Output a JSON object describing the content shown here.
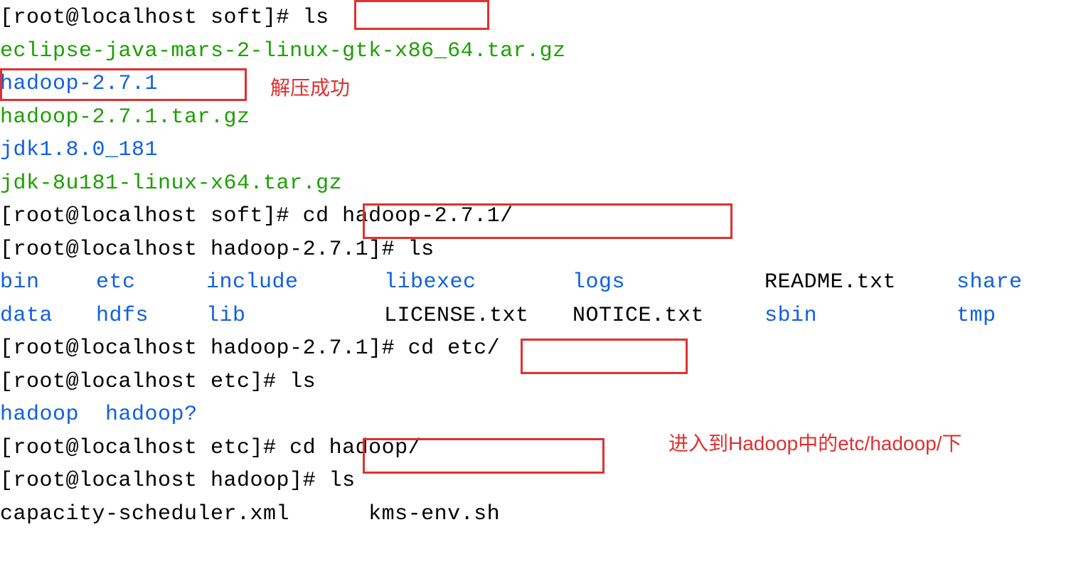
{
  "prompts": {
    "soft": "[root@localhost soft]# ",
    "hadoop271": "[root@localhost hadoop-2.7.1]# ",
    "etc": "[root@localhost etc]# ",
    "hadoop": "[root@localhost hadoop]# "
  },
  "commands": {
    "ls": "ls",
    "cd_hadoop271": "cd hadoop-2.7.1/",
    "cd_etc": "cd etc/",
    "cd_hadoop": "cd hadoop/"
  },
  "listings": {
    "soft": {
      "eclipse": "eclipse-java-mars-2-linux-gtk-x86_64.tar.gz",
      "hadoop_dir": "hadoop-2.7.1",
      "hadoop_tar": "hadoop-2.7.1.tar.gz",
      "jdk_dir": "jdk1.8.0_181",
      "jdk_tar": "jdk-8u181-linux-x64.tar.gz"
    },
    "hadoop271_row1": {
      "bin": "bin",
      "etc": "etc",
      "include": "include",
      "libexec": "libexec",
      "logs": "logs",
      "readme": "README.txt",
      "share": "share"
    },
    "hadoop271_row2": {
      "data": "data",
      "hdfs": "hdfs",
      "lib": "lib",
      "license": "LICENSE.txt",
      "notice": "NOTICE.txt",
      "sbin": "sbin",
      "tmp": "tmp"
    },
    "etc": {
      "hadoop": "hadoop",
      "hadoopq": "hadoop?"
    },
    "hadoop_row1": {
      "capacity": "capacity-scheduler.xml",
      "kms": "kms-env.sh"
    }
  },
  "annotations": {
    "extract_success": "解压成功",
    "enter_etc_hadoop": "进入到Hadoop中的etc/hadoop/下"
  }
}
